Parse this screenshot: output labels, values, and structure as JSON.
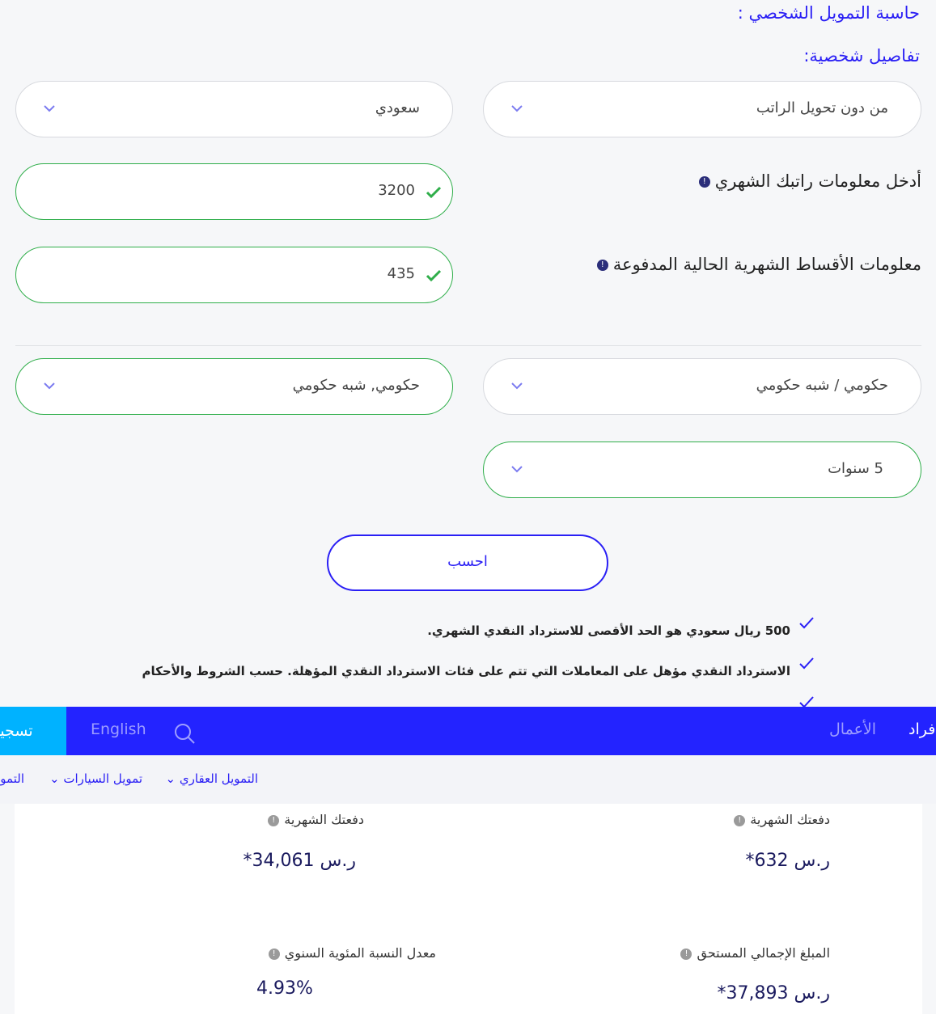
{
  "header": {
    "title": "حاسبة التمويل الشخصي :",
    "section": "تفاصيل شخصية:"
  },
  "fields": {
    "salary_transfer": "من دون تحويل الراتب",
    "nationality": "سعودي",
    "salary_label": "أدخل معلومات راتبك الشهري",
    "salary_value": "3200",
    "installments_label": "معلومات الأقساط الشهرية الحالية المدفوعة",
    "installments_value": "435",
    "sector": "حكومي / شبه حكومي",
    "employer": "حكومي, شبه حكومي",
    "tenure": "5 سنوات"
  },
  "calculate_label": "احسب",
  "bullets": [
    "500 ريال سعودي هو الحد الأقصى للاسترداد النقدي الشهري.",
    "الاسترداد النقدي مؤهل على المعاملات التي تتم على فئات الاسترداد النقدي المؤهلة. حسب الشروط والأحكام"
  ],
  "nav": {
    "register": "تسجيل",
    "english": "English",
    "business": "الأعمال",
    "individuals": "أفراد"
  },
  "subnav": [
    "التمويل العقاري",
    "تمويل السيارات",
    "التمويل"
  ],
  "results": [
    {
      "label": "دفعتك الشهرية",
      "value": "ر.س 632*"
    },
    {
      "label": "دفعتك الشهرية",
      "value": "ر.س 34,061*"
    },
    {
      "label": "المبلغ الإجمالي المستحق",
      "value": "ر.س 37,893*"
    },
    {
      "label": "معدل النسبة المئوية السنوي",
      "value": "4.93%"
    }
  ],
  "colors": {
    "accent": "#2a1ff5",
    "nav": "#2323ff",
    "register": "#00b2ff",
    "valid": "#2fae4a"
  }
}
